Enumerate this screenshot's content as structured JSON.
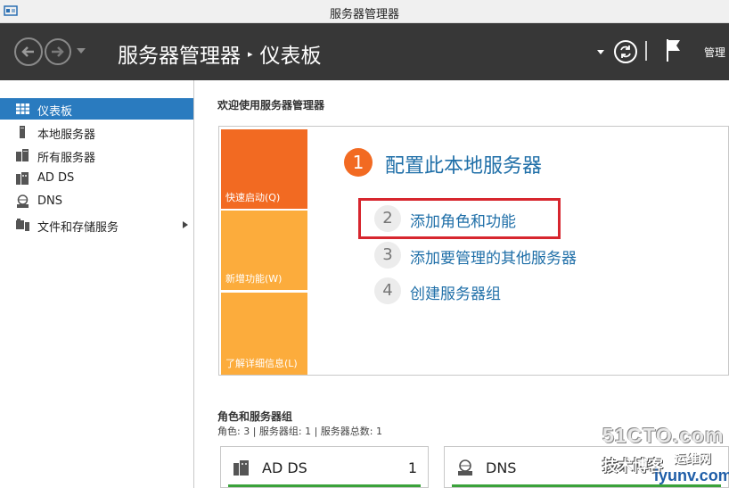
{
  "window": {
    "title": "服务器管理器"
  },
  "header": {
    "breadcrumb_root": "服务器管理器",
    "breadcrumb_sep": "▸",
    "breadcrumb_current": "仪表板",
    "manage_label": "管理"
  },
  "sidebar": {
    "items": [
      {
        "label": "仪表板",
        "icon": "dashboard-icon",
        "active": true
      },
      {
        "label": "本地服务器",
        "icon": "server-icon",
        "active": false
      },
      {
        "label": "所有服务器",
        "icon": "servers-icon",
        "active": false
      },
      {
        "label": "AD DS",
        "icon": "ad-ds-icon",
        "active": false
      },
      {
        "label": "DNS",
        "icon": "dns-icon",
        "active": false
      },
      {
        "label": "文件和存储服务",
        "icon": "file-storage-icon",
        "active": false,
        "has_submenu": true
      }
    ]
  },
  "welcome": {
    "title": "欢迎使用服务器管理器",
    "tiles": [
      "快速启动(Q)",
      "新增功能(W)",
      "了解详细信息(L)"
    ],
    "steps": [
      {
        "num": "1",
        "label": "配置此本地服务器"
      },
      {
        "num": "2",
        "label": "添加角色和功能"
      },
      {
        "num": "3",
        "label": "添加要管理的其他服务器"
      },
      {
        "num": "4",
        "label": "创建服务器组"
      }
    ]
  },
  "roles": {
    "title": "角色和服务器组",
    "summary": "角色: 3 | 服务器组: 1 | 服务器总数: 1",
    "cards": [
      {
        "name": "AD DS",
        "count": "1"
      },
      {
        "name": "DNS",
        "count": ""
      }
    ]
  },
  "watermark": {
    "site": "51CTO.com",
    "blog": "技术博客",
    "yunwei": "运维网",
    "domain": "iyunv.com"
  },
  "colors": {
    "accent": "#2a7bbf",
    "header_bg": "#373737",
    "tile_primary": "#f26a22",
    "tile_secondary": "#fcac3c",
    "link": "#1f6fa8",
    "highlight_box": "#d7262e",
    "status_green": "#3aa23a"
  }
}
